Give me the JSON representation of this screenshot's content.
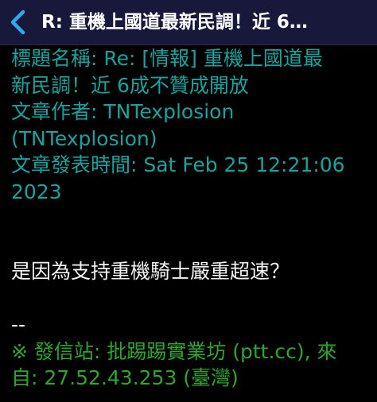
{
  "nav": {
    "title": "R: 重機上國道最新民調！近 6…",
    "back_icon": "chevron-left-icon",
    "accent": "#2ea8f0",
    "bar_color": "#18183a"
  },
  "header_lines": [
    "標題名稱: Re: [情報] 重機上國道最",
    "新民調！近 6成不贊成開放",
    "文章作者: TNTexplosion",
    "(TNTexplosion)",
    "文章發表時間: Sat Feb 25 12:21:06",
    "2023"
  ],
  "body_text": "是因為支持重機騎士嚴重超速？",
  "signature": {
    "separator": "--",
    "line1": "※ 發信站: 批踢踢實業坊 (ptt.cc), 來",
    "line2": "自: 27.52.43.253 (臺灣)"
  },
  "colors": {
    "background": "#000000",
    "header_text": "#19a3a0",
    "body_text": "#f2f2f2",
    "signature_text": "#2fa52f"
  }
}
